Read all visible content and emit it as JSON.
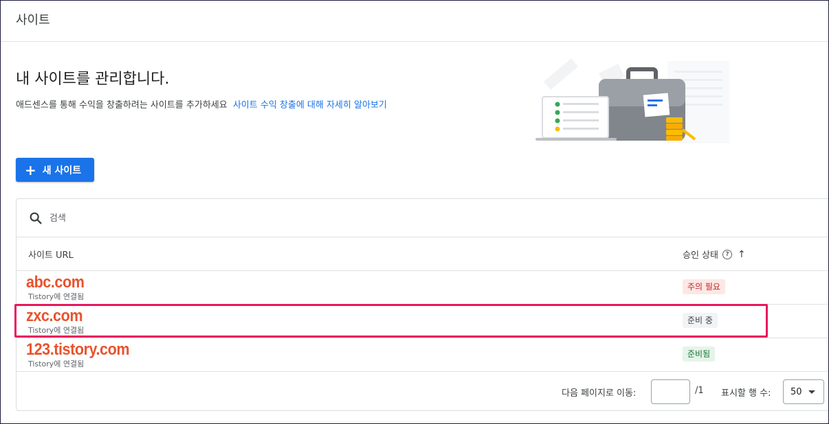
{
  "header": {
    "title": "사이트"
  },
  "hero": {
    "heading": "내 사이트를 관리합니다.",
    "description": "애드센스를 통해 수익을 창출하려는 사이트를 추가하세요",
    "learn_more": "사이트 수익 창출에 대해 자세히 알아보기"
  },
  "toolbar": {
    "new_site_label": "새 사이트"
  },
  "search": {
    "placeholder": "검색",
    "value": ""
  },
  "table": {
    "columns": {
      "url": "사이트 URL",
      "status": "승인 상태"
    },
    "rows": [
      {
        "url": "abc.com",
        "subtitle": "Tistory에 연결됨",
        "status": "주의 필요",
        "status_type": "warning"
      },
      {
        "url": "zxc.com",
        "subtitle": "Tistory에 연결됨",
        "status": "준비 중",
        "status_type": "neutral"
      },
      {
        "url": "123.tistory.com",
        "subtitle": "Tistory에 연결됨",
        "status": "준비됨",
        "status_type": "ready"
      }
    ]
  },
  "pagination": {
    "goto_label": "다음 페이지로 이동:",
    "page_value": "",
    "total_pages": "/1",
    "rows_per_page_label": "표시할 행 수:",
    "rows_per_page_value": "50"
  },
  "colors": {
    "accent": "#1a73e8",
    "site_url": "#e8532e",
    "highlight": "#e8175d",
    "warning_bg": "#fce8e6",
    "ready_bg": "#e6f4ea"
  },
  "icons": {
    "search": "search-icon",
    "help": "help-icon",
    "sort": "arrow-up-icon",
    "add": "plus-icon",
    "dropdown": "chevron-down-icon"
  }
}
